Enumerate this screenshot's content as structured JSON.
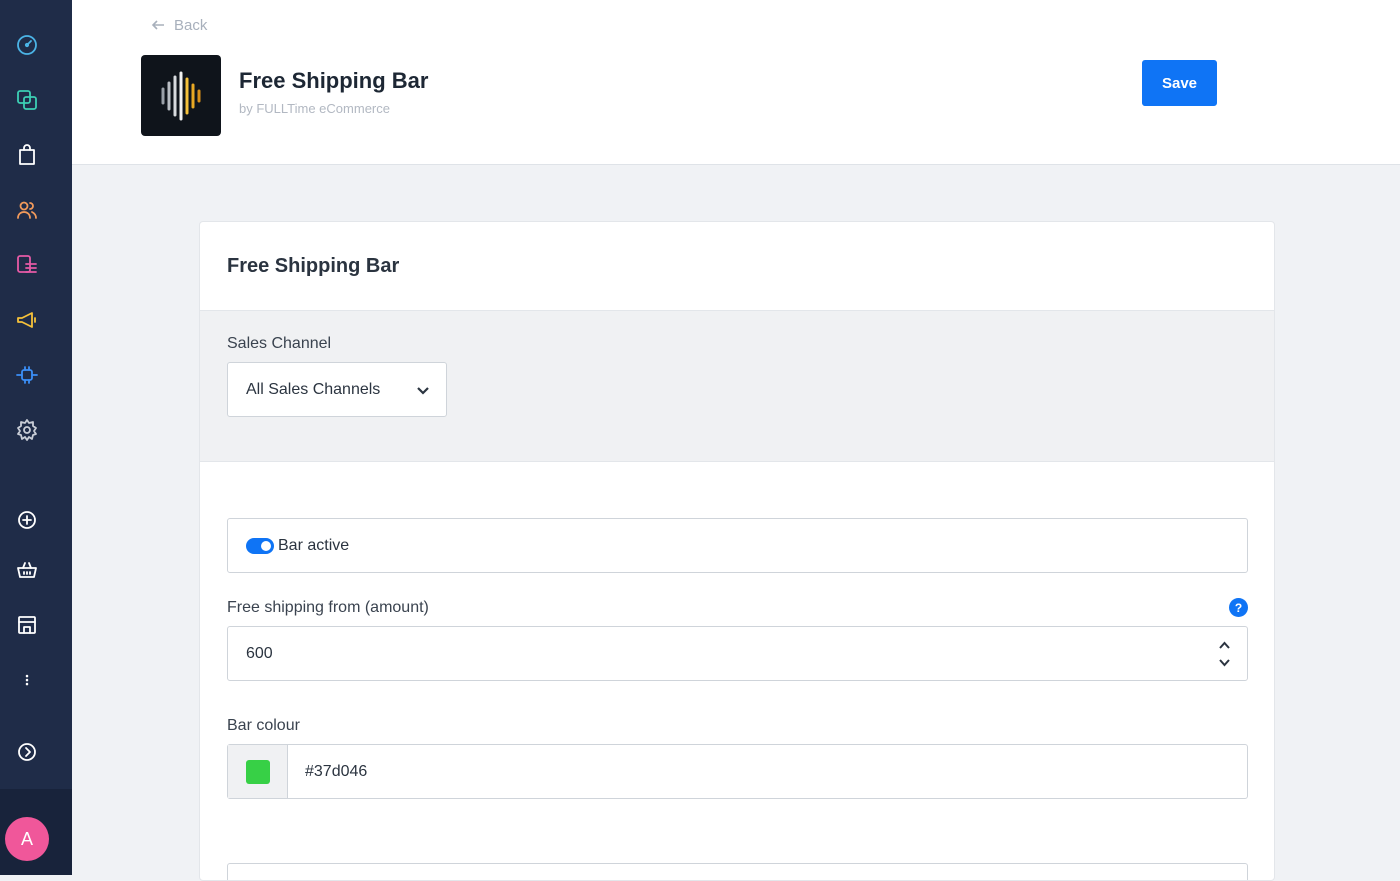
{
  "header": {
    "back_label": "Back",
    "app_title": "Free Shipping Bar",
    "app_subtitle": "by FULLTime eCommerce",
    "save_label": "Save"
  },
  "sidebar": {
    "items": [
      {
        "icon": "dashboard-icon",
        "color": "#4bb4e6"
      },
      {
        "icon": "layers-icon",
        "color": "#3ccfb4"
      },
      {
        "icon": "shopping-bag-icon",
        "color": "#ffffff"
      },
      {
        "icon": "customers-icon",
        "color": "#f29a5b"
      },
      {
        "icon": "content-icon",
        "color": "#e55aa6"
      },
      {
        "icon": "megaphone-icon",
        "color": "#f5c13a"
      },
      {
        "icon": "plugin-icon",
        "color": "#3b8ff7"
      },
      {
        "icon": "settings-icon",
        "color": "#c8cdd6"
      },
      {
        "icon": "add-circle-icon",
        "color": "#ffffff"
      },
      {
        "icon": "basket-icon",
        "color": "#ffffff"
      },
      {
        "icon": "store-icon",
        "color": "#ffffff"
      },
      {
        "icon": "more-vertical-icon",
        "color": "#ffffff"
      },
      {
        "icon": "expand-circle-icon",
        "color": "#ffffff"
      }
    ],
    "avatar_initial": "A",
    "avatar_color": "#f0579a"
  },
  "card": {
    "title": "Free Shipping Bar",
    "sales_channel": {
      "label": "Sales Channel",
      "selected": "All Sales Channels"
    },
    "bar_active": {
      "label": "Bar active",
      "checked": true
    },
    "free_shipping": {
      "label": "Free shipping from (amount)",
      "value": "600",
      "help_glyph": "?"
    },
    "bar_colour": {
      "label": "Bar colour",
      "value": "#37d046"
    }
  },
  "colors": {
    "accent": "#0f74f5",
    "sidebar_bg": "#1f2c48",
    "swatch": "#37d046"
  }
}
